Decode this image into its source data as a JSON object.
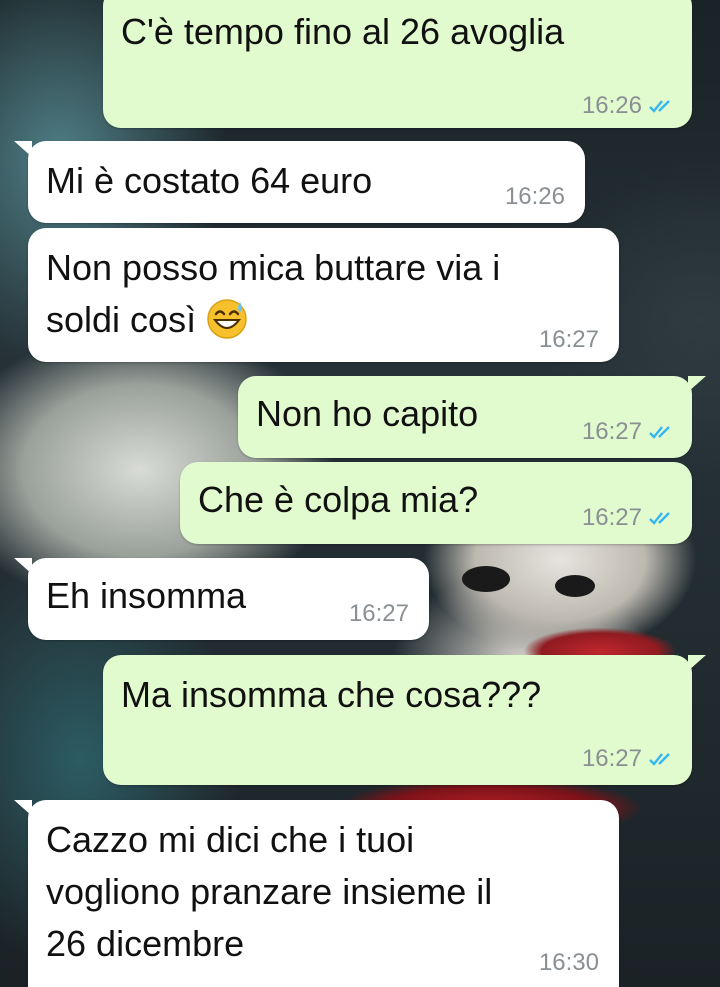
{
  "messages": [
    {
      "direction": "out",
      "text": "C'è tempo fino al 26 avoglia",
      "time": "16:26",
      "status": "read"
    },
    {
      "direction": "in",
      "text": "Mi è costato 64 euro",
      "time": "16:26"
    },
    {
      "direction": "in",
      "text": "Non posso mica buttare via i\nsoldi così",
      "emoji": "grinning-face-with-sweat",
      "time": "16:27"
    },
    {
      "direction": "out",
      "text": "Non ho capito",
      "time": "16:27",
      "status": "read"
    },
    {
      "direction": "out",
      "text": "Che è colpa mia?",
      "time": "16:27",
      "status": "read"
    },
    {
      "direction": "in",
      "text": "Eh insomma",
      "time": "16:27"
    },
    {
      "direction": "out",
      "text": "Ma insomma che cosa???",
      "time": "16:27",
      "status": "read"
    },
    {
      "direction": "in",
      "text": "Cazzo mi dici che i tuoi\nvogliono pranzare insieme il\n26 dicembre",
      "time": "16:30"
    }
  ],
  "colors": {
    "incoming_bubble": "#ffffff",
    "outgoing_bubble": "#e1fbcf",
    "read_ticks": "#34b7f1",
    "timestamp": "#8a8f93"
  }
}
